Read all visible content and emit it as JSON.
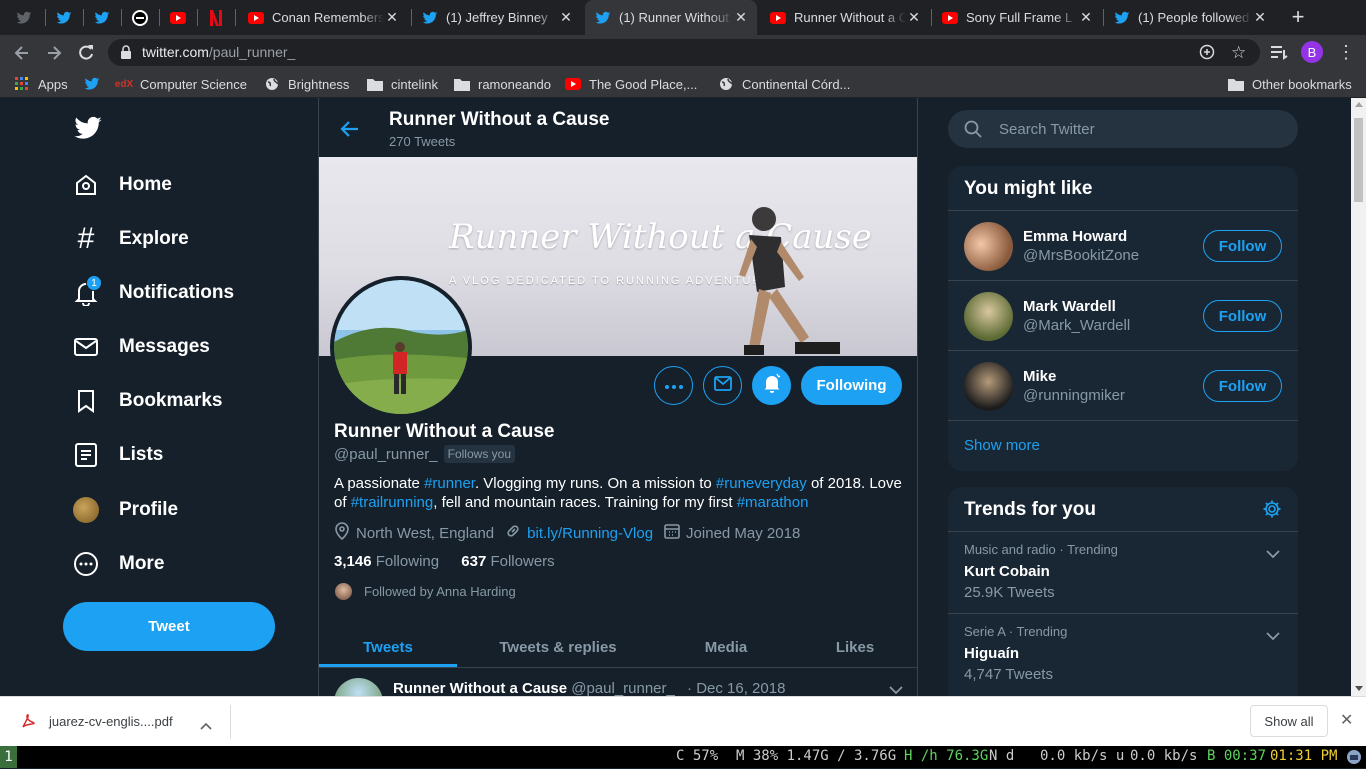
{
  "browser": {
    "tabs": [
      {
        "title": "",
        "icon": "twitter-icon"
      },
      {
        "title": "",
        "icon": "twitter-icon"
      },
      {
        "title": "",
        "icon": "site-icon"
      },
      {
        "title": "",
        "icon": "youtube-icon"
      },
      {
        "title": "",
        "icon": "netflix-icon"
      },
      {
        "title": "Conan Remembers",
        "icon": "youtube-icon"
      },
      {
        "title": "(1) Jeffrey Binney",
        "icon": "twitter-icon"
      },
      {
        "title": "(1) Runner Without",
        "icon": "twitter-icon"
      },
      {
        "title": "Runner Without a C",
        "icon": "youtube-icon"
      },
      {
        "title": "Sony Full Frame L",
        "icon": "youtube-icon"
      },
      {
        "title": "(1) People followed",
        "icon": "twitter-icon"
      }
    ],
    "url_domain": "twitter.com",
    "url_path": "/paul_runner_",
    "profile_initial": "B",
    "bookmarks": [
      {
        "label": "Apps",
        "icon": "apps-grid-icon"
      },
      {
        "label": "",
        "icon": "twitter-icon"
      },
      {
        "label": "Computer Science",
        "icon": "edx-icon"
      },
      {
        "label": "Brightness",
        "icon": "globe-icon"
      },
      {
        "label": "cintelink",
        "icon": "folder-icon"
      },
      {
        "label": "ramoneando",
        "icon": "folder-icon"
      },
      {
        "label": "The Good Place,...",
        "icon": "youtube-icon"
      },
      {
        "label": "Continental Córd...",
        "icon": "globe-icon"
      }
    ],
    "other_bookmarks": "Other bookmarks"
  },
  "sidebar": {
    "items": [
      {
        "label": "Home",
        "icon": "home-icon"
      },
      {
        "label": "Explore",
        "icon": "hashtag-icon"
      },
      {
        "label": "Notifications",
        "icon": "bell-icon",
        "badge": "1"
      },
      {
        "label": "Messages",
        "icon": "envelope-icon"
      },
      {
        "label": "Bookmarks",
        "icon": "bookmark-icon"
      },
      {
        "label": "Lists",
        "icon": "list-icon"
      },
      {
        "label": "Profile",
        "icon": "avatar-icon"
      },
      {
        "label": "More",
        "icon": "more-circle-icon"
      }
    ],
    "tweet_button": "Tweet"
  },
  "header": {
    "name": "Runner Without a Cause",
    "tweet_count": "270 Tweets"
  },
  "banner": {
    "title": "Runner Without a Cause",
    "subtitle": "A VLOG DEDICATED TO RUNNING ADVENTURES"
  },
  "profile": {
    "name": "Runner Without a Cause",
    "handle": "@paul_runner_",
    "follows_you": "Follows you",
    "following_button": "Following",
    "bio": {
      "t1": "A passionate ",
      "h1": "#runner",
      "t2": ". Vlogging my runs. On a mission to ",
      "h2": "#runeveryday",
      "t3": " of 2018. Love of ",
      "h3": "#trailrunning",
      "t4": ", fell and mountain races. Training for my first ",
      "h4": "#marathon"
    },
    "location": "North West, England",
    "website": "bit.ly/Running-Vlog",
    "joined": "Joined May 2018",
    "following_count": "3,146",
    "following_label": "Following",
    "followers_count": "637",
    "followers_label": "Followers",
    "followed_by": "Followed by Anna Harding"
  },
  "tabs": [
    {
      "label": "Tweets",
      "active": true
    },
    {
      "label": "Tweets & replies",
      "active": false
    },
    {
      "label": "Media",
      "active": false
    },
    {
      "label": "Likes",
      "active": false
    }
  ],
  "first_tweet": {
    "name": "Runner Without a Cause",
    "handle": "@paul_runner_",
    "date": "· Dec 16, 2018"
  },
  "search": {
    "placeholder": "Search Twitter"
  },
  "who_to_follow": {
    "title": "You might like",
    "users": [
      {
        "name": "Emma Howard",
        "handle": "@MrsBookitZone",
        "button": "Follow"
      },
      {
        "name": "Mark Wardell",
        "handle": "@Mark_Wardell",
        "button": "Follow"
      },
      {
        "name": "Mike",
        "handle": "@runningmiker",
        "button": "Follow"
      }
    ],
    "show_more": "Show more"
  },
  "trends": {
    "title": "Trends for you",
    "items": [
      {
        "context": "Music and radio · Trending",
        "name": "Kurt Cobain",
        "count": "25.9K Tweets"
      },
      {
        "context": "Serie A · Trending",
        "name": "Higuaín",
        "count": "4,747 Tweets"
      }
    ]
  },
  "download": {
    "file": "juarez-cv-englis....pdf",
    "show_all": "Show all"
  },
  "statusbar": {
    "workspace": "1",
    "cpu": "C 57%",
    "mem": "M 38%  1.47G / 3.76G",
    "disk": "H /h 76.3G",
    "net_label": "N d",
    "up": "0.0 kb/s u",
    "down": "0.0 kb/s",
    "battery": "B 00:37",
    "time": "01:31 PM"
  },
  "colors": {
    "accent": "#1da1f2",
    "background": "#15202b",
    "panel": "#192734",
    "border": "#38444d",
    "secondary_text": "#8899a6"
  }
}
